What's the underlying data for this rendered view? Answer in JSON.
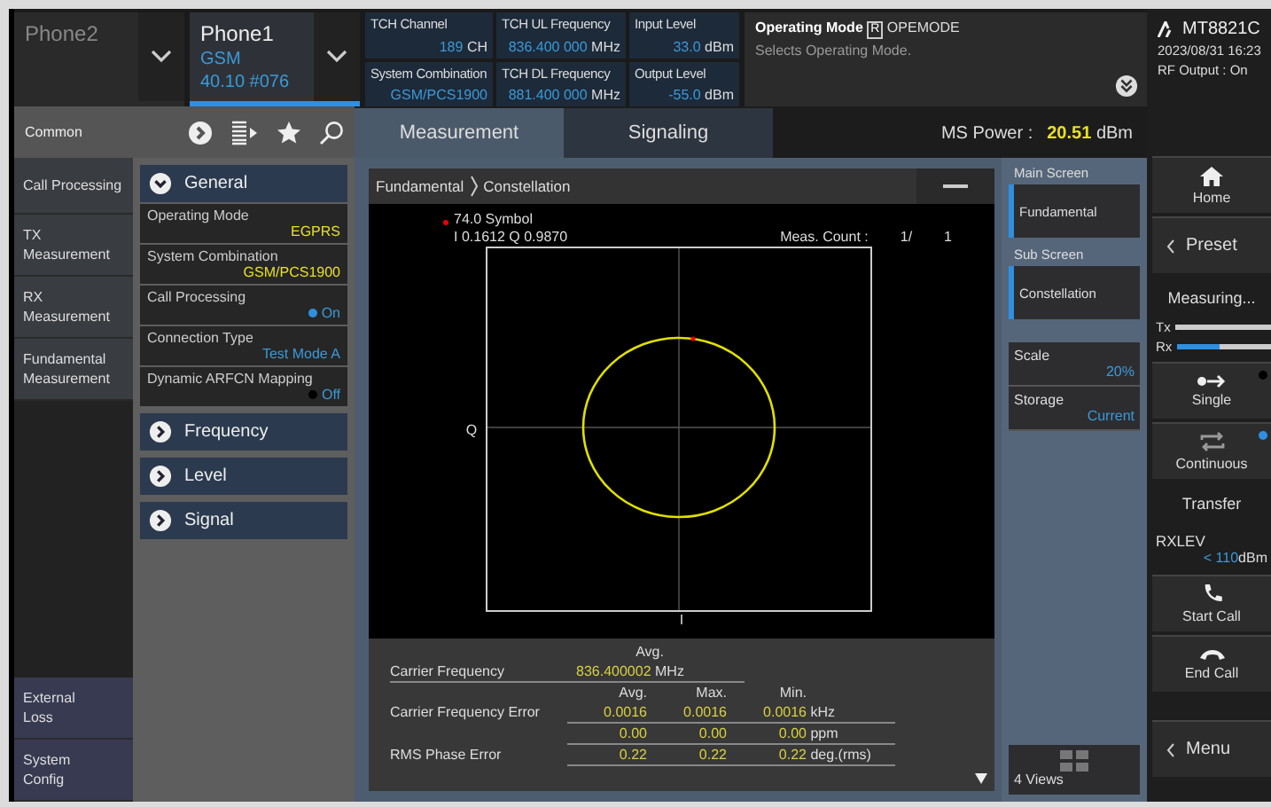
{
  "phones": [
    {
      "name": "Phone2",
      "selected": false
    },
    {
      "name": "Phone1",
      "system": "GSM",
      "version": "40.10 #076",
      "selected": true
    }
  ],
  "parameters": [
    {
      "label": "TCH Channel",
      "value": "189",
      "unit": "CH"
    },
    {
      "label": "System Combination",
      "value": "GSM/PCS1900"
    },
    {
      "label": "TCH UL Frequency",
      "value": "836.400 000",
      "unit": "MHz"
    },
    {
      "label": "TCH DL Frequency",
      "value": "881.400 000",
      "unit": "MHz"
    },
    {
      "label": "Input Level",
      "value": "33.0",
      "unit": "dBm"
    },
    {
      "label": "Output Level",
      "value": "-55.0",
      "unit": "dBm"
    }
  ],
  "help": {
    "title": "Operating Mode",
    "badge": "R",
    "command": "OPEMODE",
    "text": "Selects Operating Mode."
  },
  "instrument": {
    "model": "MT8821C",
    "datetime": "2023/08/31 16:23",
    "status": "RF Output : On"
  },
  "toolbar": {
    "label": "Common"
  },
  "tabs": [
    {
      "label": "Measurement",
      "selected": true
    },
    {
      "label": "Signaling",
      "selected": false
    }
  ],
  "ms_power": {
    "label": "MS Power :",
    "value": "20.51",
    "unit": "dBm"
  },
  "nav": {
    "items": [
      {
        "lines": [
          "Call Processing"
        ]
      },
      {
        "lines": [
          "TX",
          "Measurement"
        ]
      },
      {
        "lines": [
          "RX",
          "Measurement"
        ]
      },
      {
        "lines": [
          "Fundamental",
          "Measurement"
        ]
      }
    ],
    "bottom_items": [
      {
        "lines": [
          "External",
          "Loss"
        ]
      },
      {
        "lines": [
          "System",
          "Config"
        ]
      }
    ]
  },
  "settings": {
    "groups": [
      {
        "title": "General",
        "expanded": true,
        "params": [
          {
            "label": "Operating Mode",
            "value": "EGPRS",
            "kind": "value"
          },
          {
            "label": "System Combination",
            "value": "GSM/PCS1900",
            "kind": "value"
          },
          {
            "label": "Call Processing",
            "value": "On",
            "kind": "toggle",
            "on": true
          },
          {
            "label": "Connection Type",
            "value": "Test Mode A",
            "kind": "option"
          },
          {
            "label": "Dynamic ARFCN Mapping",
            "value": "Off",
            "kind": "toggle",
            "on": false
          }
        ]
      },
      {
        "title": "Frequency",
        "expanded": false
      },
      {
        "title": "Level",
        "expanded": false
      },
      {
        "title": "Signal",
        "expanded": false
      }
    ]
  },
  "panel": {
    "breadcrumb": [
      "Fundamental",
      "Constellation"
    ],
    "marker": {
      "symbol": "74.0 Symbol",
      "position": "I 0.1612 Q 0.9870"
    },
    "meas_count": {
      "label": "Meas. Count :",
      "current": "1/",
      "total": "1"
    },
    "y_axis": "Q",
    "x_axis": "I"
  },
  "results": {
    "carrier_frequency": {
      "label": "Carrier Frequency",
      "header": "Avg.",
      "value": "836.400002",
      "unit": "MHz"
    },
    "columns": [
      "Avg.",
      "Max.",
      "Min."
    ],
    "rows": [
      {
        "label": "Carrier Frequency Error",
        "values": [
          "0.0016",
          "0.0016",
          "0.0016"
        ],
        "unit": "kHz"
      },
      {
        "values": [
          "0.00",
          "0.00",
          "0.00"
        ],
        "unit": "ppm"
      },
      {
        "label": "RMS Phase Error",
        "values": [
          "0.22",
          "0.22",
          "0.22"
        ],
        "unit": "deg.(rms)"
      }
    ]
  },
  "screens": [
    {
      "label": "Main Screen",
      "value": "Fundamental"
    },
    {
      "label": "Sub Screen",
      "value": "Constellation"
    }
  ],
  "display_settings": [
    {
      "label": "Scale",
      "value": "20%"
    },
    {
      "label": "Storage",
      "value": "Current"
    }
  ],
  "views": {
    "label": "4 Views"
  },
  "sidebar": [
    {
      "kind": "home",
      "label": "Home"
    },
    {
      "kind": "back",
      "label": "Preset"
    },
    {
      "kind": "status",
      "label": "Measuring..."
    },
    {
      "kind": "meters",
      "meters": [
        {
          "label": "Tx"
        },
        {
          "label": "Rx",
          "level": 0.45
        }
      ]
    },
    {
      "kind": "single",
      "label": "Single",
      "selected": false
    },
    {
      "kind": "continuous",
      "label": "Continuous",
      "selected": true
    },
    {
      "kind": "status",
      "label": "Transfer"
    },
    {
      "kind": "reading",
      "label": "RXLEV",
      "prefix": "<",
      "value": "110",
      "unit": "dBm"
    },
    {
      "kind": "call",
      "label": "Start Call"
    },
    {
      "kind": "hangup",
      "label": "End Call"
    },
    {
      "kind": "menu",
      "label": "Menu"
    }
  ]
}
